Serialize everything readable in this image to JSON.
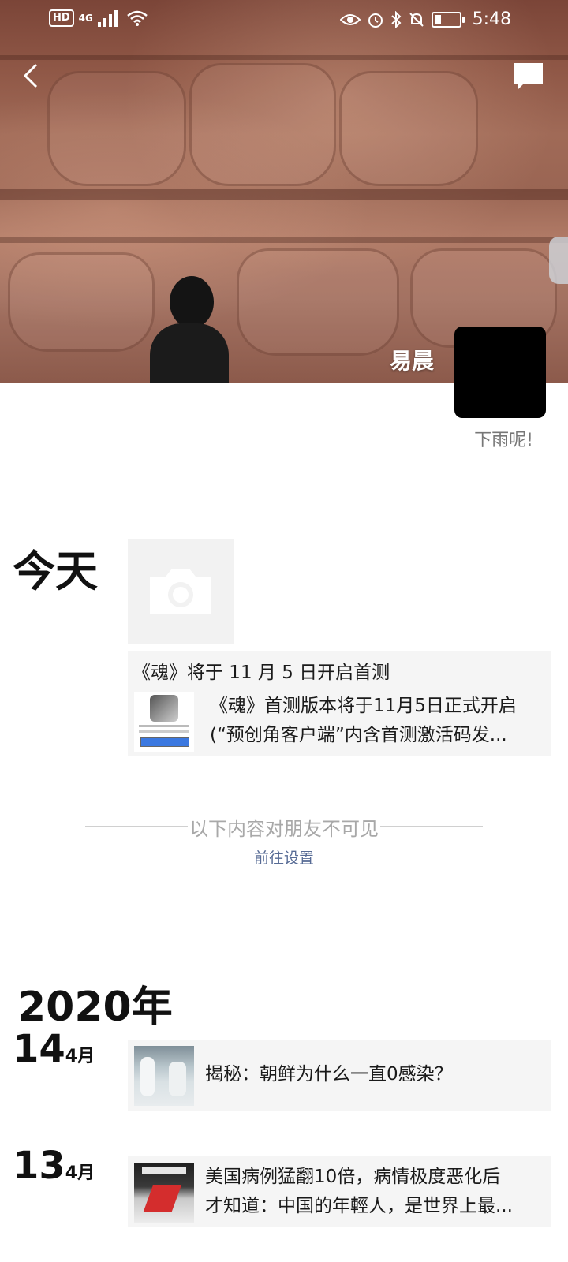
{
  "status_bar": {
    "hd": "HD",
    "network": "4G",
    "time": "5:48"
  },
  "profile": {
    "nickname": "易晨",
    "signature": "下雨呢!"
  },
  "today": {
    "label": "今天",
    "share_title": "《魂》将于 11 月 5 日开启首测",
    "share_desc_line1": "《魂》首测版本将于11月5日正式开启",
    "share_desc_line2": "(“预创角客户端”内含首测激活码发..."
  },
  "visibility": {
    "notice": "以下内容对朋友不可见",
    "settings_link": "前往设置"
  },
  "timeline": {
    "year": "2020年",
    "posts": [
      {
        "day": "14",
        "month": "4月",
        "line1": "揭秘：朝鲜为什么一直0感染？",
        "line2": ""
      },
      {
        "day": "13",
        "month": "4月",
        "line1": "美国病例猛翻10倍，病情极度恶化后",
        "line2": "才知道：中国的年輕人，是世界上最..."
      }
    ]
  },
  "colors": {
    "link": "#576b95",
    "card_bg": "#f5f5f5"
  }
}
